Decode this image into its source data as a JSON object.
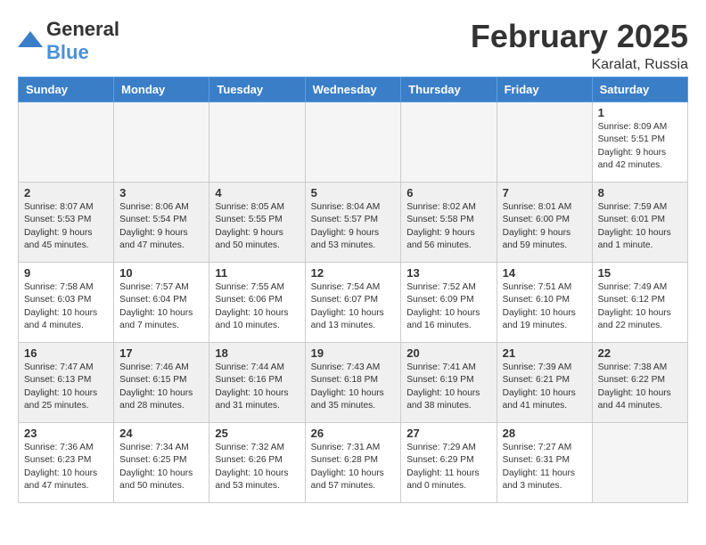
{
  "logo": {
    "general": "General",
    "blue": "Blue"
  },
  "header": {
    "month": "February 2025",
    "location": "Karalat, Russia"
  },
  "weekdays": [
    "Sunday",
    "Monday",
    "Tuesday",
    "Wednesday",
    "Thursday",
    "Friday",
    "Saturday"
  ],
  "weeks": [
    {
      "shaded": false,
      "days": [
        {
          "date": "",
          "info": ""
        },
        {
          "date": "",
          "info": ""
        },
        {
          "date": "",
          "info": ""
        },
        {
          "date": "",
          "info": ""
        },
        {
          "date": "",
          "info": ""
        },
        {
          "date": "",
          "info": ""
        },
        {
          "date": "1",
          "info": "Sunrise: 8:09 AM\nSunset: 5:51 PM\nDaylight: 9 hours and 42 minutes."
        }
      ]
    },
    {
      "shaded": true,
      "days": [
        {
          "date": "2",
          "info": "Sunrise: 8:07 AM\nSunset: 5:53 PM\nDaylight: 9 hours and 45 minutes."
        },
        {
          "date": "3",
          "info": "Sunrise: 8:06 AM\nSunset: 5:54 PM\nDaylight: 9 hours and 47 minutes."
        },
        {
          "date": "4",
          "info": "Sunrise: 8:05 AM\nSunset: 5:55 PM\nDaylight: 9 hours and 50 minutes."
        },
        {
          "date": "5",
          "info": "Sunrise: 8:04 AM\nSunset: 5:57 PM\nDaylight: 9 hours and 53 minutes."
        },
        {
          "date": "6",
          "info": "Sunrise: 8:02 AM\nSunset: 5:58 PM\nDaylight: 9 hours and 56 minutes."
        },
        {
          "date": "7",
          "info": "Sunrise: 8:01 AM\nSunset: 6:00 PM\nDaylight: 9 hours and 59 minutes."
        },
        {
          "date": "8",
          "info": "Sunrise: 7:59 AM\nSunset: 6:01 PM\nDaylight: 10 hours and 1 minute."
        }
      ]
    },
    {
      "shaded": false,
      "days": [
        {
          "date": "9",
          "info": "Sunrise: 7:58 AM\nSunset: 6:03 PM\nDaylight: 10 hours and 4 minutes."
        },
        {
          "date": "10",
          "info": "Sunrise: 7:57 AM\nSunset: 6:04 PM\nDaylight: 10 hours and 7 minutes."
        },
        {
          "date": "11",
          "info": "Sunrise: 7:55 AM\nSunset: 6:06 PM\nDaylight: 10 hours and 10 minutes."
        },
        {
          "date": "12",
          "info": "Sunrise: 7:54 AM\nSunset: 6:07 PM\nDaylight: 10 hours and 13 minutes."
        },
        {
          "date": "13",
          "info": "Sunrise: 7:52 AM\nSunset: 6:09 PM\nDaylight: 10 hours and 16 minutes."
        },
        {
          "date": "14",
          "info": "Sunrise: 7:51 AM\nSunset: 6:10 PM\nDaylight: 10 hours and 19 minutes."
        },
        {
          "date": "15",
          "info": "Sunrise: 7:49 AM\nSunset: 6:12 PM\nDaylight: 10 hours and 22 minutes."
        }
      ]
    },
    {
      "shaded": true,
      "days": [
        {
          "date": "16",
          "info": "Sunrise: 7:47 AM\nSunset: 6:13 PM\nDaylight: 10 hours and 25 minutes."
        },
        {
          "date": "17",
          "info": "Sunrise: 7:46 AM\nSunset: 6:15 PM\nDaylight: 10 hours and 28 minutes."
        },
        {
          "date": "18",
          "info": "Sunrise: 7:44 AM\nSunset: 6:16 PM\nDaylight: 10 hours and 31 minutes."
        },
        {
          "date": "19",
          "info": "Sunrise: 7:43 AM\nSunset: 6:18 PM\nDaylight: 10 hours and 35 minutes."
        },
        {
          "date": "20",
          "info": "Sunrise: 7:41 AM\nSunset: 6:19 PM\nDaylight: 10 hours and 38 minutes."
        },
        {
          "date": "21",
          "info": "Sunrise: 7:39 AM\nSunset: 6:21 PM\nDaylight: 10 hours and 41 minutes."
        },
        {
          "date": "22",
          "info": "Sunrise: 7:38 AM\nSunset: 6:22 PM\nDaylight: 10 hours and 44 minutes."
        }
      ]
    },
    {
      "shaded": false,
      "days": [
        {
          "date": "23",
          "info": "Sunrise: 7:36 AM\nSunset: 6:23 PM\nDaylight: 10 hours and 47 minutes."
        },
        {
          "date": "24",
          "info": "Sunrise: 7:34 AM\nSunset: 6:25 PM\nDaylight: 10 hours and 50 minutes."
        },
        {
          "date": "25",
          "info": "Sunrise: 7:32 AM\nSunset: 6:26 PM\nDaylight: 10 hours and 53 minutes."
        },
        {
          "date": "26",
          "info": "Sunrise: 7:31 AM\nSunset: 6:28 PM\nDaylight: 10 hours and 57 minutes."
        },
        {
          "date": "27",
          "info": "Sunrise: 7:29 AM\nSunset: 6:29 PM\nDaylight: 11 hours and 0 minutes."
        },
        {
          "date": "28",
          "info": "Sunrise: 7:27 AM\nSunset: 6:31 PM\nDaylight: 11 hours and 3 minutes."
        },
        {
          "date": "",
          "info": ""
        }
      ]
    }
  ]
}
